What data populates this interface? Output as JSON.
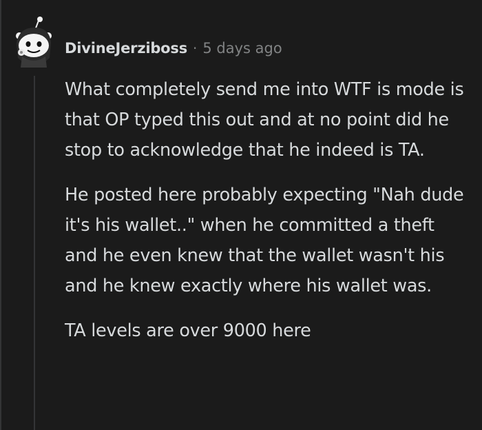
{
  "comment": {
    "author": "DivineJerziboss",
    "separator": "·",
    "time_ago": "5 days ago",
    "paragraphs": [
      "What completely send me into WTF is mode is that OP typed this out and at no point did he stop to acknowledge that he indeed is TA.",
      "He posted here probably expecting \"Nah dude it's his wallet..\" when he committed a theft and he even knew that the wallet wasn't his and he knew exactly where his wallet was.",
      "TA levels are over 9000 here"
    ]
  },
  "colors": {
    "background": "#1b1b1b",
    "text": "#d7dadc",
    "muted": "#818384",
    "thread_line": "#343536"
  },
  "icons": {
    "avatar": "snoo-avatar-icon"
  }
}
